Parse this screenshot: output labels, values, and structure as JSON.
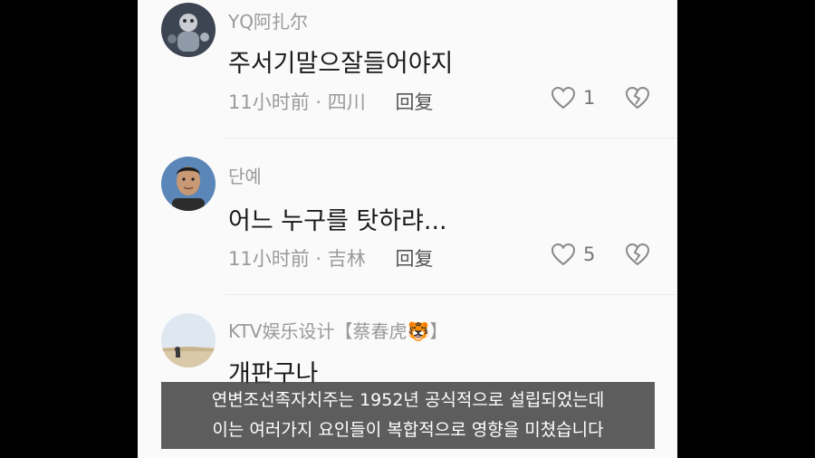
{
  "comments": [
    {
      "username": "YQ阿扎尔",
      "text": "주서기말으잘들어야지",
      "time": "11小时前",
      "location": "四川",
      "reply": "回复",
      "likes": "1"
    },
    {
      "username": "단예",
      "text": "어느 누구를 탓하랴...",
      "time": "11小时前",
      "location": "吉林",
      "reply": "回复",
      "likes": "5"
    },
    {
      "username": "KTV娱乐设计【蔡春虎🐯】",
      "text": "개판구나"
    }
  ],
  "meta_separator": "·",
  "subtitle": {
    "line1": "연변조선족자치주는 1952년 공식적으로 설립되었는데",
    "line2": "이는 여러가지 요인들이 복합적으로 영향을 미쳤습니다"
  }
}
